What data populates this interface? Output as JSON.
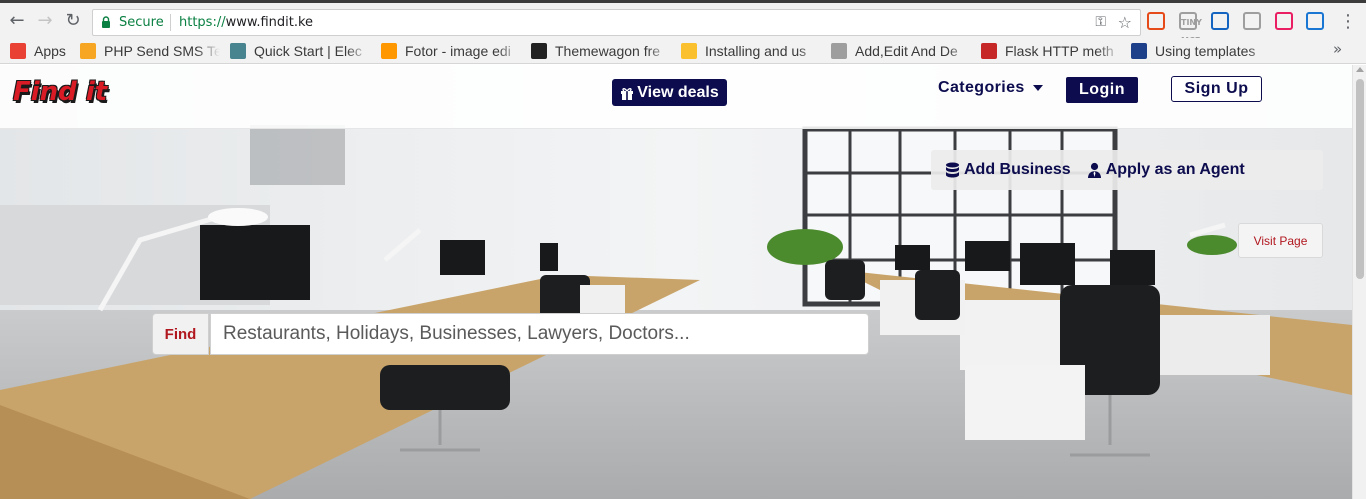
{
  "browser": {
    "secure_label": "Secure",
    "url_scheme": "https://",
    "url_host": "www.findit.ke",
    "icons": [
      "back-icon",
      "forward-icon",
      "reload-icon",
      "lock-icon",
      "key-icon",
      "star-icon",
      "menu-icon"
    ],
    "extensions": [
      {
        "name": "office-extension-icon",
        "label": "",
        "color": "#e64a19"
      },
      {
        "name": "tinymce-extension-icon",
        "label": "TINY MCE",
        "color": "#9e9e9e"
      },
      {
        "name": "angular-extension-icon",
        "label": "",
        "color": "#1565c0"
      },
      {
        "name": "react-extension-icon",
        "label": "",
        "color": "#9e9e9e"
      },
      {
        "name": "color-extension-icon",
        "label": "",
        "color": "#e91e63"
      },
      {
        "name": "user-extension-icon",
        "label": "",
        "color": "#1976d2"
      }
    ]
  },
  "bookmarks": {
    "more_label": "»",
    "items": [
      {
        "label": "Apps",
        "color": "#e94235"
      },
      {
        "label": "PHP Send SMS Te",
        "color": "#f6a623"
      },
      {
        "label": "Quick Start | Elec",
        "color": "#47848f"
      },
      {
        "label": "Fotor - image edi",
        "color": "#ff9800"
      },
      {
        "label": "Themewagon fre",
        "color": "#222222"
      },
      {
        "label": "Installing and us",
        "color": "#fbc02d"
      },
      {
        "label": "Add,Edit And De",
        "color": "#9e9e9e"
      },
      {
        "label": "Flask HTTP meth",
        "color": "#c62828"
      },
      {
        "label": "Using templates",
        "color": "#1e3f8a"
      }
    ]
  },
  "site": {
    "logo": "Find it",
    "deals_label": "View deals",
    "categories_label": "Categories",
    "login_label": "Login",
    "signup_label": "Sign Up",
    "add_business_label": "Add Business",
    "apply_agent_label": "Apply as an Agent",
    "visit_page_label": "Visit Page",
    "search": {
      "label": "Find",
      "placeholder": "Restaurants, Holidays, Businesses, Lawyers, Doctors..."
    },
    "colors": {
      "brand_navy": "#0c0c4e",
      "brand_red": "#d81b25"
    }
  }
}
